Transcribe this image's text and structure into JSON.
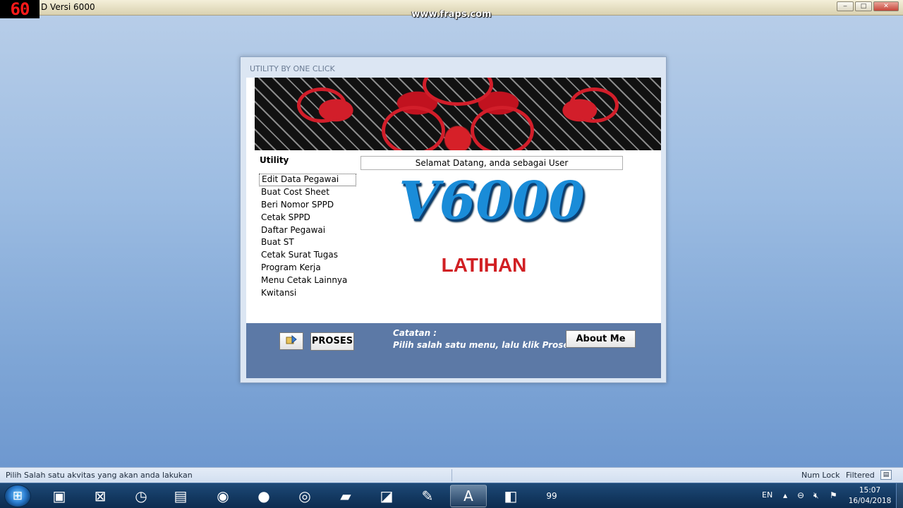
{
  "app": {
    "fps_counter": "60",
    "title": "D Versi 6000",
    "watermark": "www.fraps.com",
    "window_controls": {
      "minimize": "‒",
      "maximize": "□",
      "close": "✕"
    }
  },
  "dialog": {
    "title": "UTILITY BY ONE CLICK",
    "utility_heading": "Utility",
    "menu_items": [
      "Edit Data Pegawai",
      "Buat Cost Sheet",
      "Beri Nomor SPPD",
      "Cetak SPPD",
      "Daftar Pegawai",
      "Buat ST",
      "Cetak Surat Tugas",
      "Program Kerja",
      "Menu Cetak Lainnya",
      "Kwitansi"
    ],
    "selected_item": "Edit Data Pegawai",
    "welcome": "Selamat Datang, anda sebagai User",
    "logo_text": "V6000",
    "mode_text": "LATIHAN",
    "proses_label": "PROSES",
    "note_title": "Catatan :",
    "note_text": "Pilih salah satu menu, lalu klik Proses",
    "about_label": "About Me"
  },
  "statusbar": {
    "message": "Pilih Salah satu akvitas yang akan anda lakukan",
    "numlock": "Num Lock",
    "filtered": "Filtered"
  },
  "taskbar": {
    "items": [
      {
        "name": "media-center-icon",
        "glyph": "▣",
        "active": false
      },
      {
        "name": "network-app-icon",
        "glyph": "⊠",
        "active": false
      },
      {
        "name": "clock-app-icon",
        "glyph": "◷",
        "active": false
      },
      {
        "name": "explorer-icon",
        "glyph": "▤",
        "active": false
      },
      {
        "name": "green-app-icon",
        "glyph": "◉",
        "active": false
      },
      {
        "name": "firefox-icon",
        "glyph": "●",
        "active": false
      },
      {
        "name": "chrome-icon",
        "glyph": "◎",
        "active": false
      },
      {
        "name": "folder-icon",
        "glyph": "▰",
        "active": false
      },
      {
        "name": "windows-tool-icon",
        "glyph": "◪",
        "active": false
      },
      {
        "name": "paint-icon",
        "glyph": "✎",
        "active": false
      },
      {
        "name": "access-icon",
        "glyph": "A",
        "active": true
      },
      {
        "name": "program-icon",
        "glyph": "◧",
        "active": false
      },
      {
        "name": "fraps-icon",
        "glyph": "99",
        "active": false
      }
    ],
    "language": "EN",
    "time": "15:07",
    "date": "16/04/2018"
  },
  "colors": {
    "logo": "#1a8cd8",
    "mode_text": "#d11f23",
    "panel": "#5c79a6"
  }
}
